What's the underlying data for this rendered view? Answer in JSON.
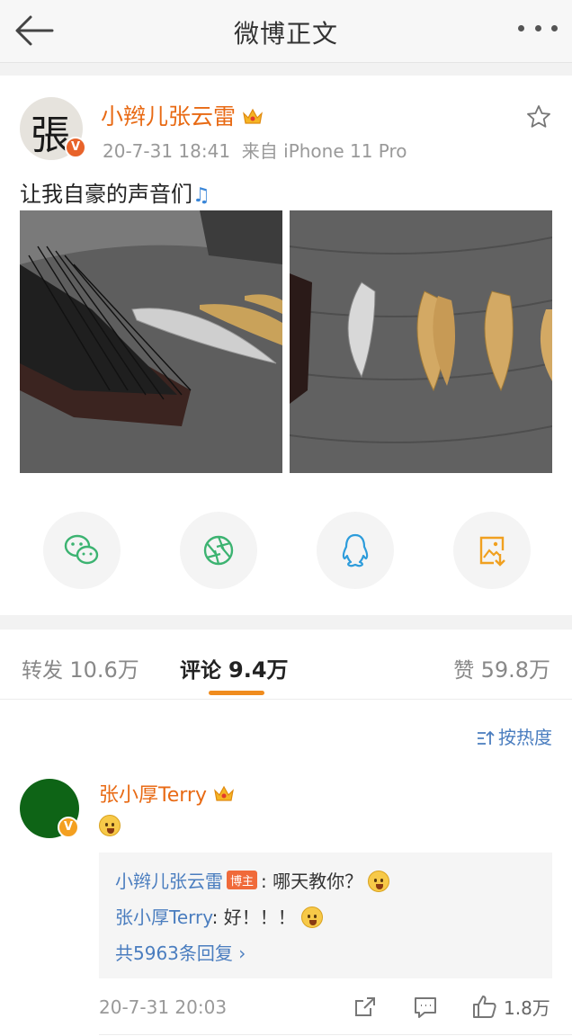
{
  "header": {
    "title": "微博正文",
    "back_icon": "arrow-left-icon",
    "more_icon": "more-dots-icon"
  },
  "post": {
    "author": "小辫儿张云雷",
    "avatar_char": "張",
    "badge": "V",
    "timestamp": "20-7-31 18:41",
    "source": "来自 iPhone 11 Pro",
    "text": "让我自豪的声音们",
    "text_emoji": "♫",
    "favorite_icon": "star-outline-icon",
    "images": [
      {
        "name": "post-image-1"
      },
      {
        "name": "post-image-2"
      }
    ]
  },
  "share": [
    {
      "name": "wechat",
      "icon": "wechat-icon",
      "color": "#3cb371"
    },
    {
      "name": "moments",
      "icon": "moments-aperture-icon",
      "color": "#3cb371"
    },
    {
      "name": "qq",
      "icon": "qq-penguin-icon",
      "color": "#2d9cdb"
    },
    {
      "name": "save-image",
      "icon": "save-image-icon",
      "color": "#f0a020"
    }
  ],
  "tabs": {
    "repost_label": "转发",
    "repost_count": "10.6万",
    "comment_label": "评论",
    "comment_count": "9.4万",
    "like_label": "赞",
    "like_count": "59.8万"
  },
  "sort": {
    "label": "按热度",
    "icon": "sort-icon"
  },
  "comment": {
    "author": "张小厚Terry",
    "badge": "V",
    "replies": {
      "r1_name": "小辫儿张云雷",
      "r1_tag": "博主",
      "r1_text": ": 哪天教你？",
      "r2_name": "张小厚Terry",
      "r2_text": ": 好！！！",
      "more": "共5963条回复 ›"
    },
    "timestamp": "20-7-31 20:03",
    "like_count": "1.8万"
  },
  "colors": {
    "accent": "#f08c1e",
    "name": "#e86a14",
    "link": "#4a7dbf"
  }
}
